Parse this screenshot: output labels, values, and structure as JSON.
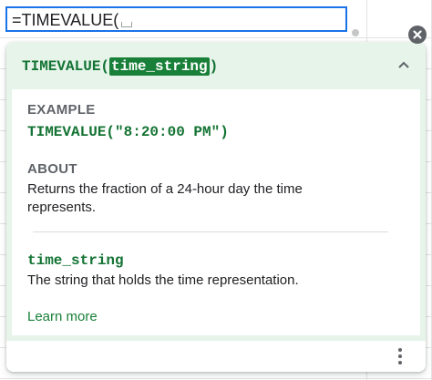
{
  "formula_bar": {
    "text": "=TIMEVALUE("
  },
  "help_popup": {
    "function_name": "TIMEVALUE(",
    "argument_highlight": "time_string",
    "closing_paren": ")",
    "example": {
      "title": "EXAMPLE",
      "code": "TIMEVALUE(\"8:20:00 PM\")"
    },
    "about": {
      "title": "ABOUT",
      "text": "Returns the fraction of a 24-hour day the time represents."
    },
    "argument": {
      "name": "time_string",
      "description": "The string that holds the time representation."
    },
    "learn_more_label": "Learn more"
  },
  "icons": {
    "collapse": "chevron-up-icon",
    "more": "more-vert-icon",
    "close": "close-icon"
  },
  "colors": {
    "accent_blue": "#1a73e8",
    "header_bg": "#e6f4ea",
    "green_text": "#137333",
    "arg_highlight_bg": "#188038",
    "link_green": "#188038"
  }
}
